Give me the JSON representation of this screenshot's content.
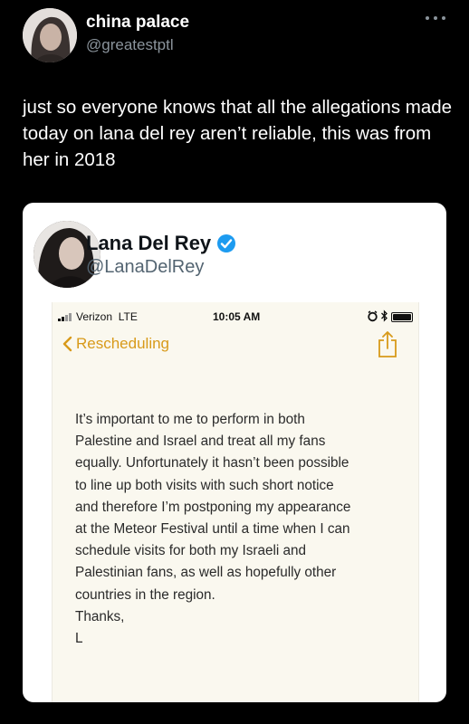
{
  "tweet": {
    "display_name": "china palace",
    "handle": "@greatestptl",
    "text": "just so everyone knows that all the allegations made today on lana del rey aren’t reliable, this was from her in 2018"
  },
  "quoted": {
    "display_name": "Lana Del Rey",
    "handle": "@LanaDelRey",
    "phone": {
      "carrier": "Verizon",
      "network": "LTE",
      "time": "10:05 AM",
      "back_label": "Rescheduling",
      "note_lines": [
        "It’s important to me to perform in both",
        "Palestine and Israel and treat all my fans",
        "equally. Unfortunately it hasn’t been possible",
        "to line up both visits with such short notice",
        "and therefore I’m postponing my appearance",
        "at the Meteor Festival until a time when I can",
        "schedule visits for both my Israeli and",
        "Palestinian fans, as well as hopefully other",
        "countries in the region.",
        "Thanks,",
        "L"
      ]
    }
  },
  "colors": {
    "background": "#000000",
    "verified": "#1d9bf0",
    "notes_accent": "#d89a1a"
  },
  "icons": [
    "more-icon",
    "verified-badge-icon",
    "signal-icon",
    "alarm-icon",
    "bluetooth-icon",
    "battery-icon",
    "chevron-left-icon",
    "share-icon"
  ]
}
